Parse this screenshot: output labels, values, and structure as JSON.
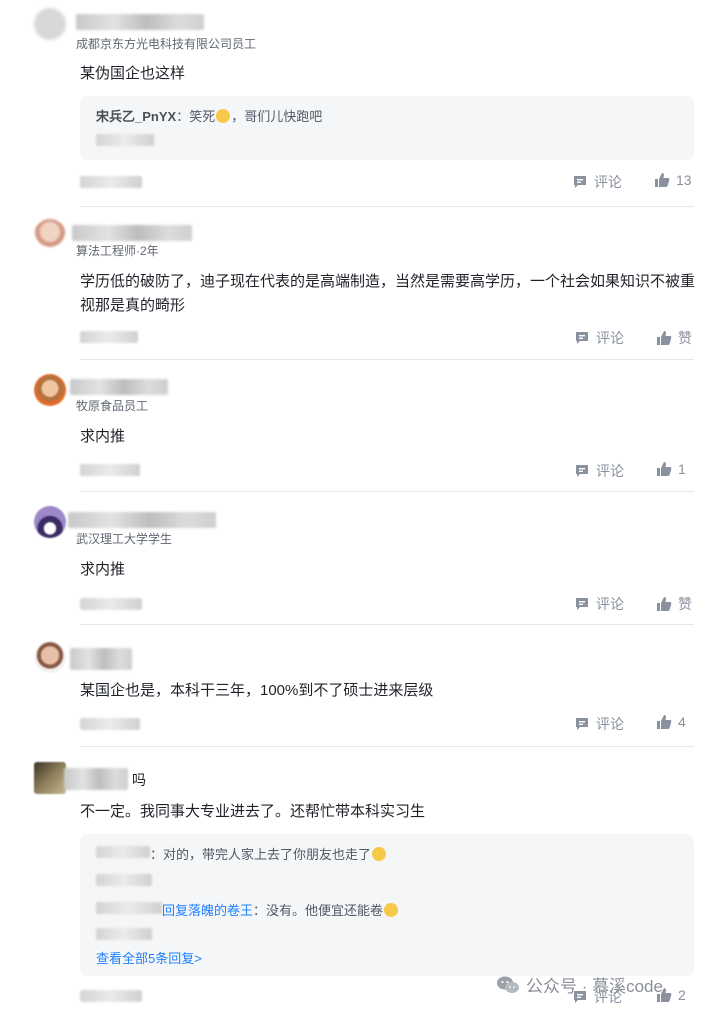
{
  "comments": [
    {
      "subtitle": "成都京东方光电科技有限公司员工",
      "body": "某伪国企也这样",
      "reply": {
        "user": "宋兵乙_PnYX",
        "text": "笑死",
        "text_after": "，哥们儿快跑吧"
      },
      "comment_label": "评论",
      "like_label": "13"
    },
    {
      "subtitle": "算法工程师·2年",
      "body": "学历低的破防了，迪子现在代表的是高端制造，当然是需要高学历，一个社会如果知识不被重视那是真的畸形",
      "comment_label": "评论",
      "like_label": "赞"
    },
    {
      "subtitle": "牧原食品员工",
      "body": "求内推",
      "comment_label": "评论",
      "like_label": "1"
    },
    {
      "subtitle": "武汉理工大学学生",
      "body": "求内推",
      "comment_label": "评论",
      "like_label": "赞"
    },
    {
      "subtitle": "",
      "body": "某国企也是，本科干三年，100%到不了硕士进来层级",
      "comment_label": "评论",
      "like_label": "4"
    },
    {
      "subtitle": "",
      "name_tail": "吗",
      "body": "不一定。我同事大专业进去了。还帮忙带本科实习生",
      "replies": [
        {
          "text": "：对的，带完人家上去了你朋友也走了"
        },
        {
          "prefix": "回复落魄的卷王",
          "text": "：没有。他便宜还能卷"
        }
      ],
      "view_all": "查看全部5条回复>",
      "comment_label": "评论",
      "like_label": "2"
    }
  ],
  "watermark": "公众号 · 慕溪code",
  "colors": {
    "link": "#1e80ff",
    "muted": "#8a919f",
    "reply_bg": "#f5f6f7"
  }
}
